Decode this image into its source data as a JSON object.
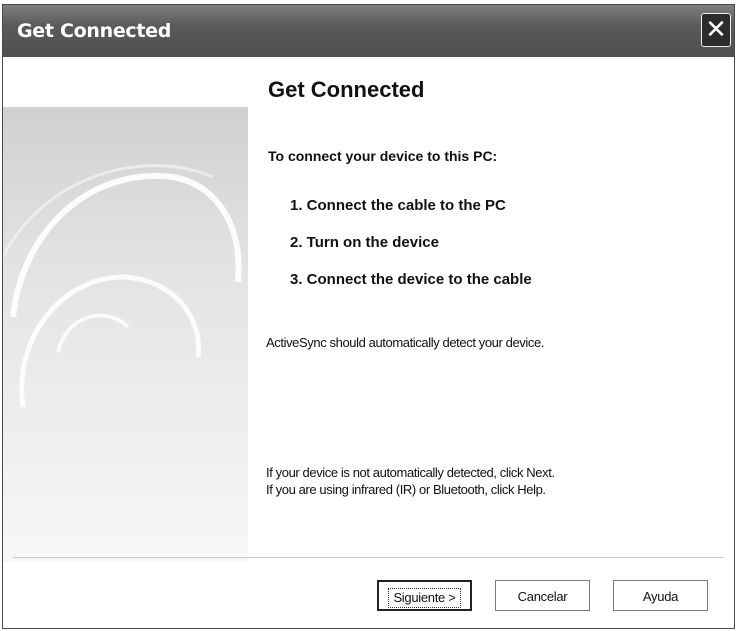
{
  "window": {
    "title": "Get Connected",
    "close_glyph": "✕"
  },
  "content": {
    "heading": "Get Connected",
    "intro": "To connect your device to this PC:",
    "steps": [
      "1. Connect the cable to the PC",
      "2. Turn on the device",
      "3. Connect the device to the cable"
    ],
    "detect_note": "ActiveSync should automatically detect your device.",
    "help_lines": [
      "If your device is not automatically detected, click Next.",
      "If you are using infrared (IR) or Bluetooth, click Help."
    ]
  },
  "buttons": {
    "next_label": "Siguiente >",
    "cancel_label": "Cancelar",
    "help_label": "Ayuda"
  },
  "colors": {
    "titlebar": "#5a5a5a",
    "text": "#111111"
  },
  "icons": {
    "close": "close-icon"
  }
}
